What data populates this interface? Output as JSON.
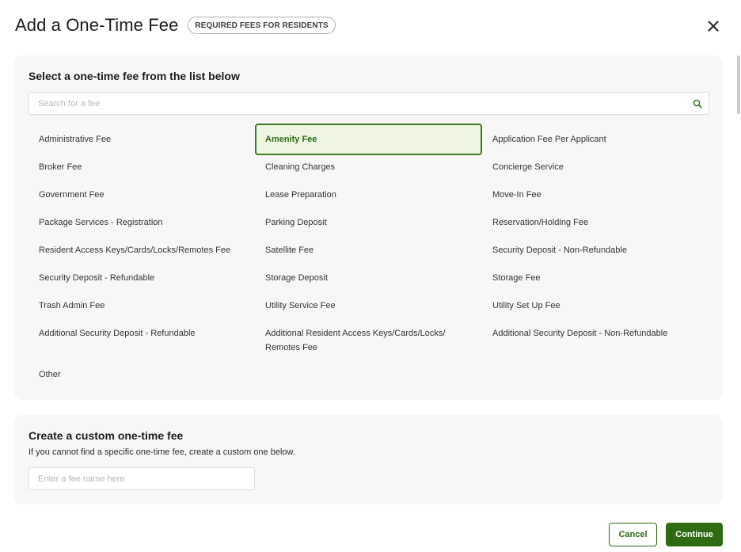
{
  "header": {
    "title": "Add a One-Time Fee",
    "badge": "REQUIRED FEES FOR RESIDENTS",
    "close_icon": "close-icon"
  },
  "fee_list": {
    "heading": "Select a one-time fee from the list below",
    "search_placeholder": "Search for a fee",
    "search_icon": "search-icon",
    "selected": "Amenity Fee",
    "items": [
      "Administrative Fee",
      "Amenity Fee",
      "Application Fee Per Applicant",
      "Broker Fee",
      "Cleaning Charges",
      "Concierge Service",
      "Government Fee",
      "Lease Preparation",
      "Move-In Fee",
      "Package Services - Registration",
      "Parking Deposit",
      "Reservation/Holding Fee",
      "Resident Access Keys/Cards/Locks/Remotes Fee",
      "Satellite Fee",
      "Security Deposit - Non-Refundable",
      "Security Deposit - Refundable",
      "Storage Deposit",
      "Storage Fee",
      "Trash Admin Fee",
      "Utility Service Fee",
      "Utility Set Up Fee",
      "Additional Security Deposit - Refundable",
      "Additional Resident Access Keys/Cards/Locks/ Remotes Fee",
      "Additional Security Deposit - Non-Refundable",
      "Other"
    ]
  },
  "custom_fee": {
    "heading": "Create a custom one-time fee",
    "description": "If you cannot find a specific one-time fee, create a custom one below.",
    "input_placeholder": "Enter a fee name here",
    "input_value": ""
  },
  "footer": {
    "cancel_label": "Cancel",
    "continue_label": "Continue"
  },
  "colors": {
    "accent": "#2f6b12",
    "selected_bg": "#edf5e3",
    "panel_bg": "#f7f7f7"
  }
}
